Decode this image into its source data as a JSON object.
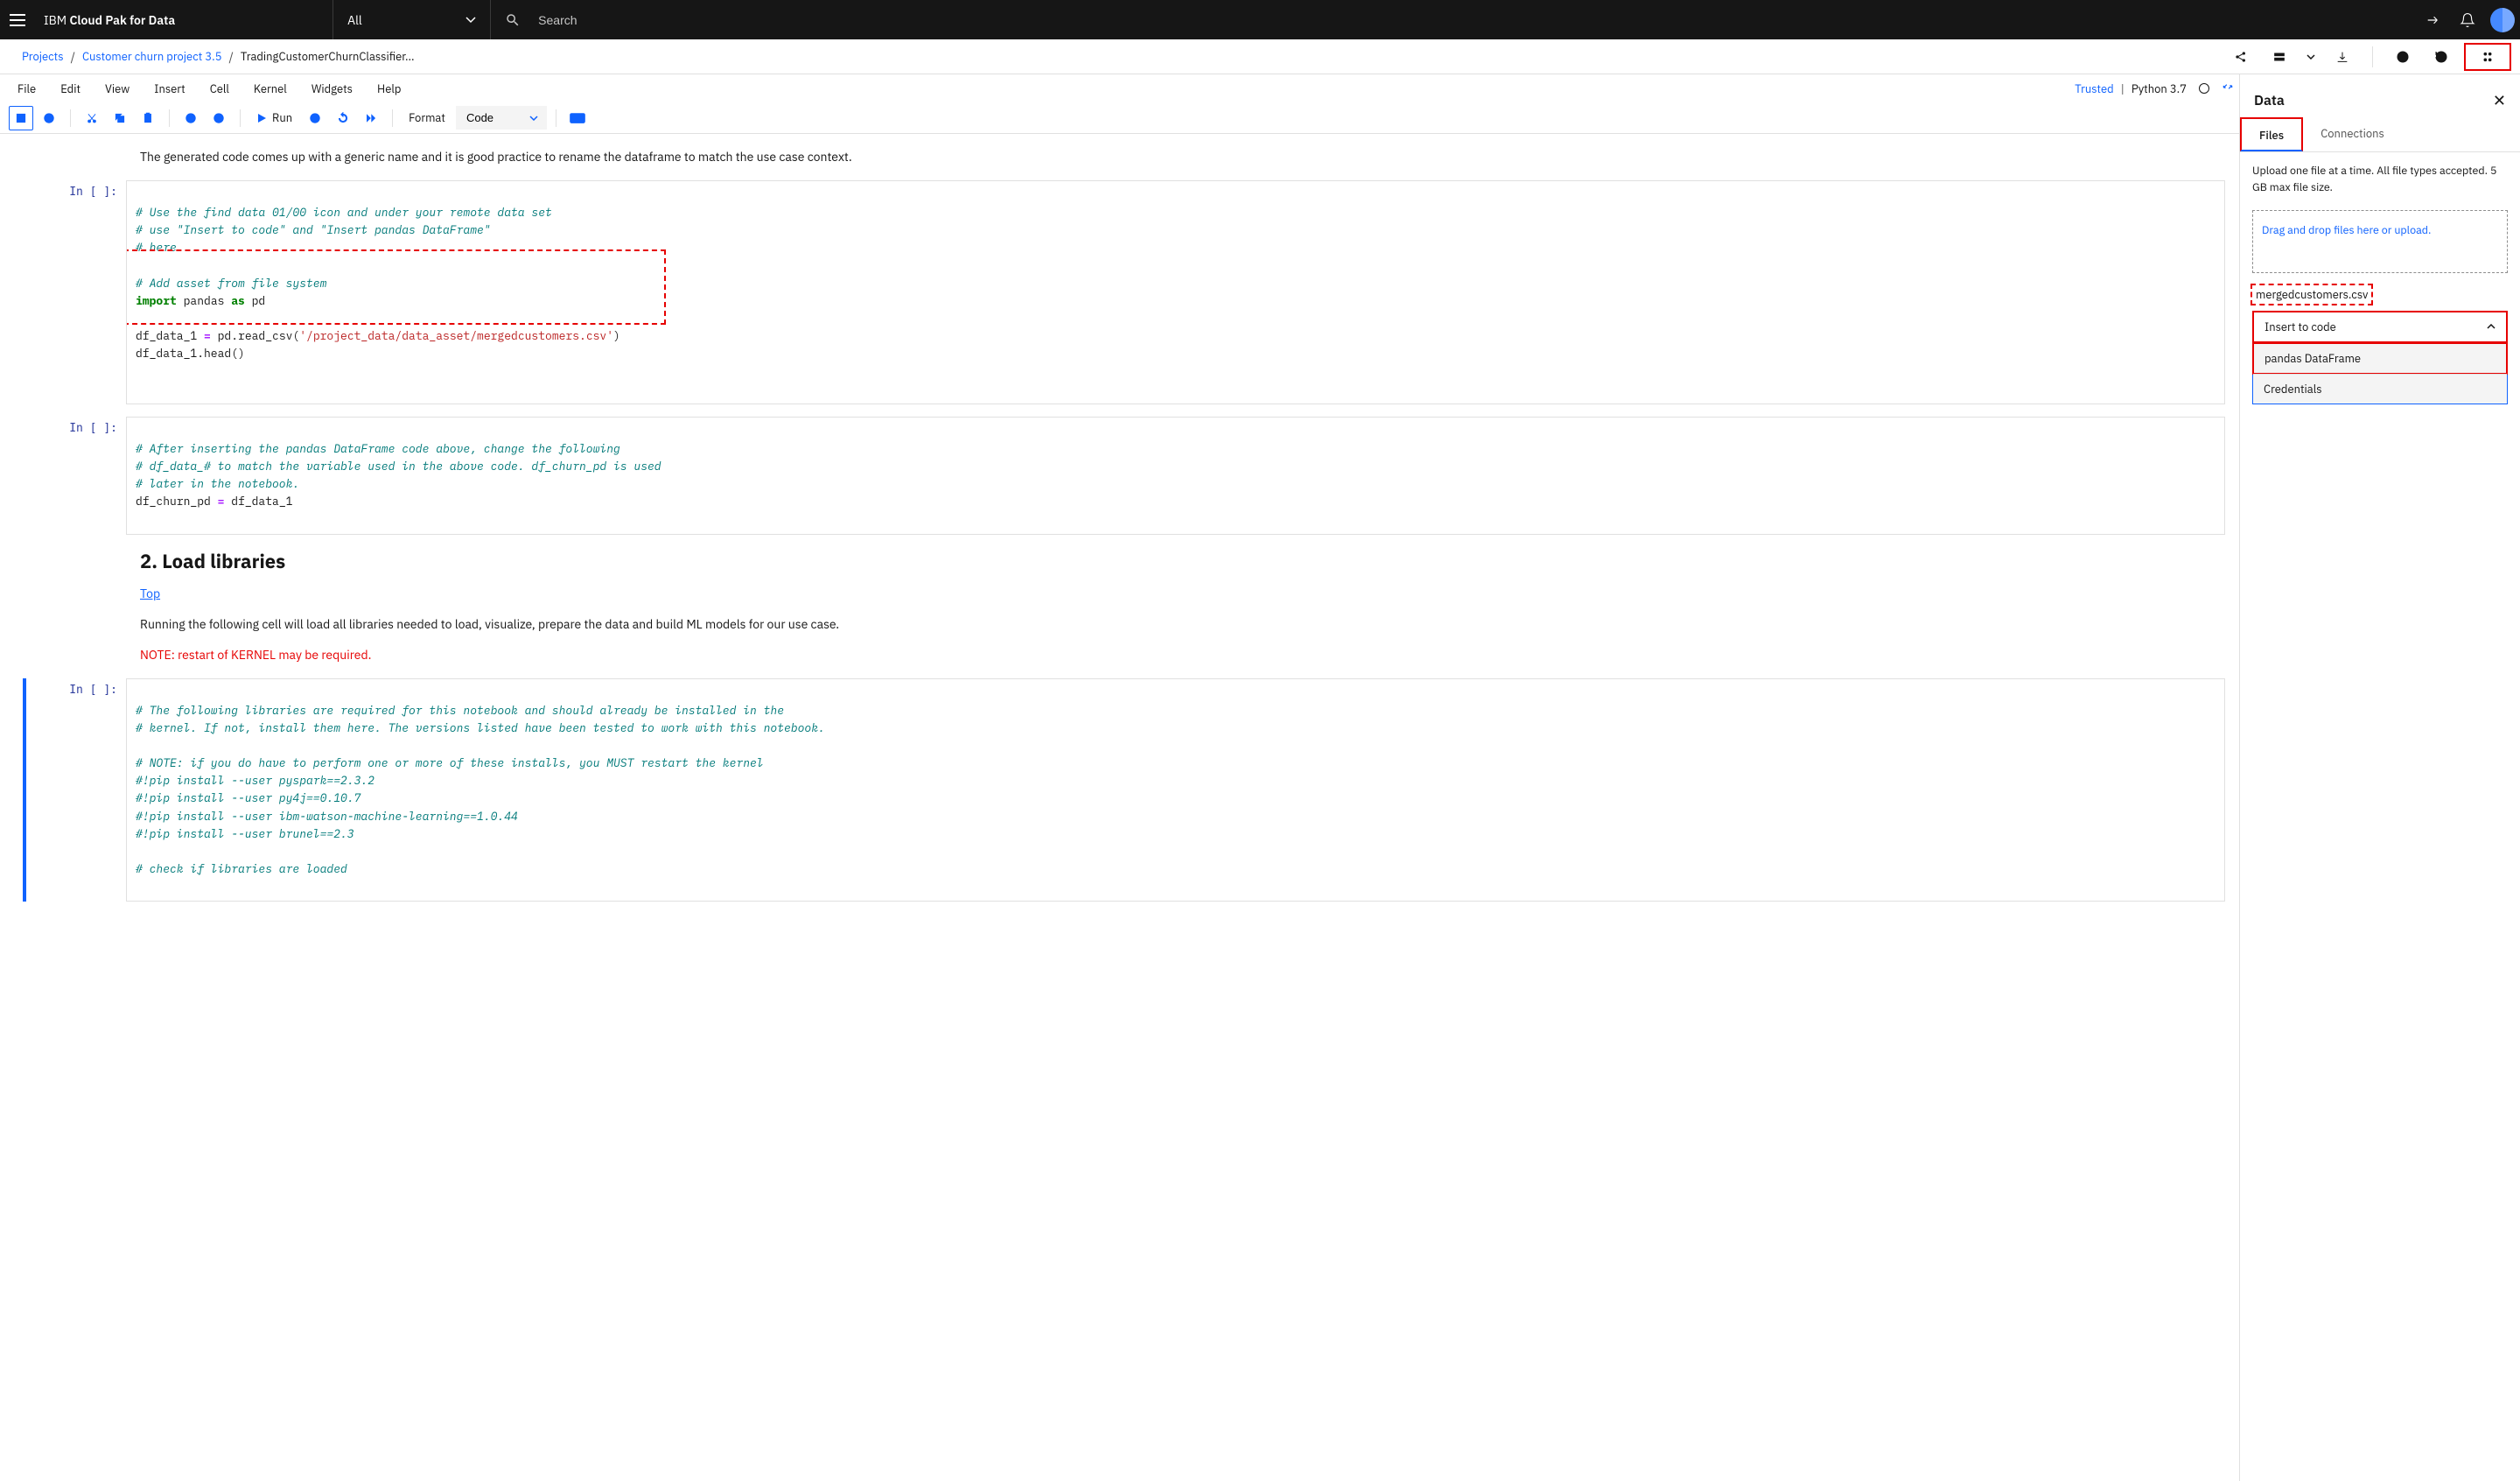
{
  "header": {
    "brand_prefix": "IBM",
    "brand_main": "Cloud Pak for Data",
    "search_scope": "All",
    "search_placeholder": "Search"
  },
  "breadcrumb": {
    "root": "Projects",
    "project": "Customer churn project 3.5",
    "asset": "TradingCustomerChurnClassifier..."
  },
  "notebook": {
    "menu": [
      "File",
      "Edit",
      "View",
      "Insert",
      "Cell",
      "Kernel",
      "Widgets",
      "Help"
    ],
    "trusted": "Trusted",
    "kernel": "Python 3.7",
    "run_label": "Run",
    "format_label": "Format",
    "format_value": "Code",
    "intro_md": "The generated code comes up with a generic name and it is good practice to rename the dataframe to match the use case context.",
    "cell1": {
      "prompt": "In [ ]:",
      "lines": [
        {
          "t": "comment",
          "v": "# Use the find data 01/00 icon and under your remote data set"
        },
        {
          "t": "comment",
          "v": "# use \"Insert to code\" and \"Insert pandas DataFrame\""
        },
        {
          "t": "comment",
          "v": "# here."
        },
        {
          "t": "blank",
          "v": ""
        },
        {
          "t": "comment",
          "v": "# Add asset from file system"
        },
        {
          "t": "code",
          "v": "import pandas as pd"
        },
        {
          "t": "blank",
          "v": ""
        },
        {
          "t": "code",
          "v": "df_data_1 = pd.read_csv('/project_data/data_asset/mergedcustomers.csv')"
        },
        {
          "t": "code",
          "v": "df_data_1.head()"
        }
      ]
    },
    "cell2": {
      "prompt": "In [ ]:",
      "lines": [
        {
          "t": "comment",
          "v": "# After inserting the pandas DataFrame code above, change the following"
        },
        {
          "t": "comment",
          "v": "# df_data_# to match the variable used in the above code. df_churn_pd is used"
        },
        {
          "t": "comment",
          "v": "# later in the notebook."
        },
        {
          "t": "code",
          "v": "df_churn_pd = df_data_1"
        }
      ]
    },
    "section2": {
      "title": "2. Load libraries",
      "top_link": "Top",
      "body": "Running the following cell will load all libraries needed to load, visualize, prepare the data and build ML models for our use case.",
      "note": "NOTE: restart of KERNEL may be required."
    },
    "cell3": {
      "prompt": "In [ ]:",
      "lines": [
        {
          "t": "comment",
          "v": "# The following libraries are required for this notebook and should already be installed in the"
        },
        {
          "t": "comment",
          "v": "# kernel. If not, install them here. The versions listed have been tested to work with this notebook."
        },
        {
          "t": "blank",
          "v": ""
        },
        {
          "t": "comment",
          "v": "# NOTE: if you do have to perform one or more of these installs, you MUST restart the kernel"
        },
        {
          "t": "comment",
          "v": "#!pip install --user pyspark==2.3.2"
        },
        {
          "t": "comment",
          "v": "#!pip install --user py4j==0.10.7"
        },
        {
          "t": "comment",
          "v": "#!pip install --user ibm-watson-machine-learning==1.0.44"
        },
        {
          "t": "comment",
          "v": "#!pip install --user brunel==2.3"
        },
        {
          "t": "blank",
          "v": ""
        },
        {
          "t": "comment",
          "v": "# check if libraries are loaded"
        }
      ]
    }
  },
  "data_panel": {
    "title": "Data",
    "tabs": {
      "files": "Files",
      "connections": "Connections"
    },
    "upload_hint": "Upload one file at a time. All file types accepted. 5 GB max file size.",
    "drop_label": "Drag and drop files here or upload.",
    "file_name": "mergedcustomers.csv",
    "insert_label": "Insert to code",
    "menu_items": [
      "pandas DataFrame",
      "Credentials"
    ]
  }
}
